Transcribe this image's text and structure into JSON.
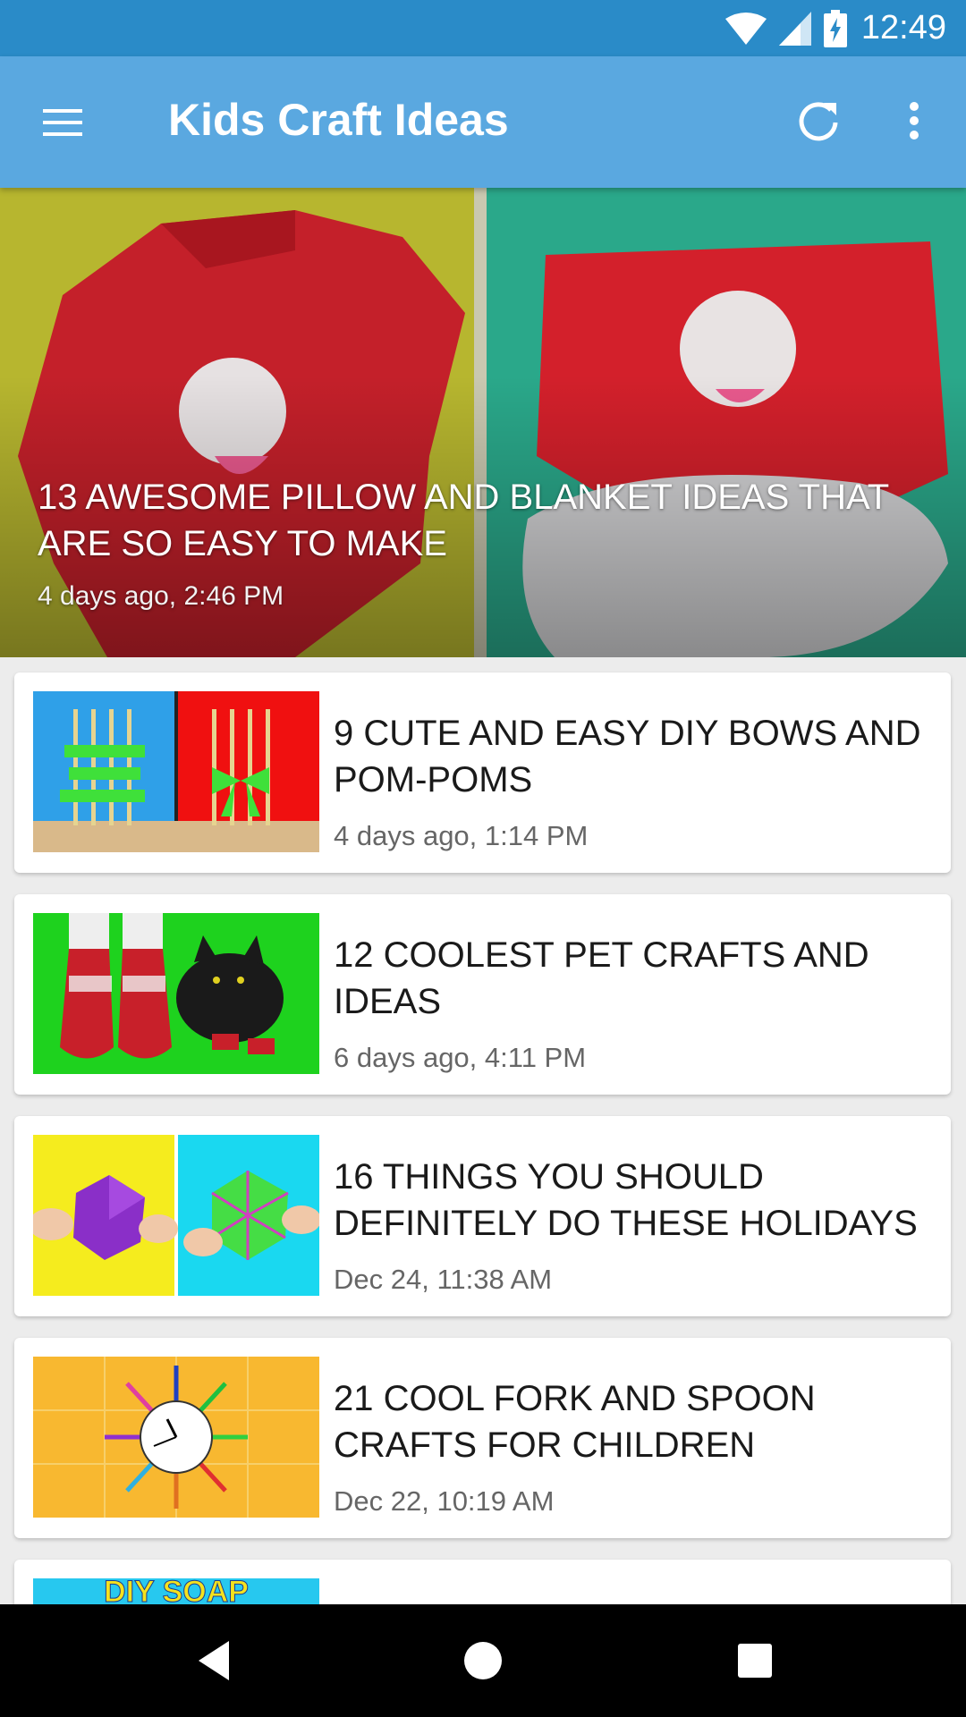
{
  "status_bar": {
    "time": "12:49",
    "icons": [
      "wifi-icon",
      "signal-icon",
      "battery-charging-icon"
    ]
  },
  "app_bar": {
    "title": "Kids Craft Ideas",
    "icons": [
      "menu-icon",
      "refresh-icon",
      "more-vert-icon"
    ]
  },
  "hero": {
    "title": "13 AWESOME PILLOW AND BLANKET IDEAS THAT ARE SO EASY TO MAKE",
    "date": "4 days ago, 2:46 PM"
  },
  "articles": [
    {
      "title": "9 CUTE AND EASY DIY BOWS AND POM-POMS",
      "date": "4 days ago, 1:14 PM"
    },
    {
      "title": "12 COOLEST PET CRAFTS AND IDEAS",
      "date": "6 days ago, 4:11 PM"
    },
    {
      "title": "16 THINGS YOU SHOULD DEFINITELY DO THESE HOLIDAYS",
      "date": "Dec 24, 11:38 AM"
    },
    {
      "title": "21 COOL FORK AND SPOON CRAFTS FOR CHILDREN",
      "date": "Dec 22, 10:19 AM"
    },
    {
      "thumb_text": "DIY SOAP"
    }
  ],
  "nav_bar": {
    "icons": [
      "back-icon",
      "home-icon",
      "recents-icon"
    ]
  },
  "colors": {
    "status_bar": "#2a8bc8",
    "app_bar": "#5aa8e0",
    "background": "#ececec"
  }
}
